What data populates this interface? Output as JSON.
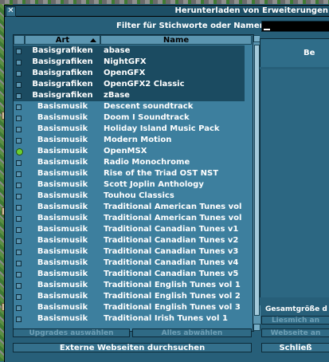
{
  "window": {
    "title": "Herunterladen von Erweiterungen",
    "close_symbol": "✕"
  },
  "filter": {
    "label": "Filter für Stichworte oder Namen:",
    "value": ""
  },
  "list": {
    "columns": {
      "type": "Art",
      "name": "Name"
    },
    "sort": "ascending",
    "rows": [
      {
        "type": "Basisgrafiken",
        "name": "abase",
        "state": "none",
        "selected": true
      },
      {
        "type": "Basisgrafiken",
        "name": "NightGFX",
        "state": "none",
        "selected": true
      },
      {
        "type": "Basisgrafiken",
        "name": "OpenGFX",
        "state": "none",
        "selected": true
      },
      {
        "type": "Basisgrafiken",
        "name": "OpenGFX2 Classic",
        "state": "none",
        "selected": true
      },
      {
        "type": "Basisgrafiken",
        "name": "zBase",
        "state": "none",
        "selected": true
      },
      {
        "type": "Basismusik",
        "name": "Descent soundtrack",
        "state": "none",
        "selected": false
      },
      {
        "type": "Basismusik",
        "name": "Doom I Soundtrack",
        "state": "none",
        "selected": false
      },
      {
        "type": "Basismusik",
        "name": "Holiday Island Music Pack",
        "state": "none",
        "selected": false
      },
      {
        "type": "Basismusik",
        "name": "Modern Motion",
        "state": "none",
        "selected": false
      },
      {
        "type": "Basismusik",
        "name": "OpenMSX",
        "state": "installed",
        "selected": false
      },
      {
        "type": "Basismusik",
        "name": "Radio Monochrome",
        "state": "none",
        "selected": false
      },
      {
        "type": "Basismusik",
        "name": "Rise of the Triad OST NST",
        "state": "none",
        "selected": false
      },
      {
        "type": "Basismusik",
        "name": "Scott Joplin Anthology",
        "state": "none",
        "selected": false
      },
      {
        "type": "Basismusik",
        "name": "Touhou Classics",
        "state": "none",
        "selected": false
      },
      {
        "type": "Basismusik",
        "name": "Traditional American Tunes vol",
        "state": "none",
        "selected": false
      },
      {
        "type": "Basismusik",
        "name": "Traditional American Tunes vol",
        "state": "none",
        "selected": false
      },
      {
        "type": "Basismusik",
        "name": "Traditional Canadian Tunes v1",
        "state": "none",
        "selected": false
      },
      {
        "type": "Basismusik",
        "name": "Traditional Canadian Tunes v2",
        "state": "none",
        "selected": false
      },
      {
        "type": "Basismusik",
        "name": "Traditional Canadian Tunes v3",
        "state": "none",
        "selected": false
      },
      {
        "type": "Basismusik",
        "name": "Traditional Canadian Tunes v4",
        "state": "none",
        "selected": false
      },
      {
        "type": "Basismusik",
        "name": "Traditional Canadian Tunes v5",
        "state": "none",
        "selected": false
      },
      {
        "type": "Basismusik",
        "name": "Traditional English Tunes vol 1",
        "state": "none",
        "selected": false
      },
      {
        "type": "Basismusik",
        "name": "Traditional English Tunes vol 2",
        "state": "none",
        "selected": false
      },
      {
        "type": "Basismusik",
        "name": "Traditional English Tunes vol 3",
        "state": "none",
        "selected": false
      },
      {
        "type": "Basismusik",
        "name": "Traditional Irish Tunes vol 1",
        "state": "none",
        "selected": false
      }
    ]
  },
  "buttons": {
    "select_upgrades": "Upgrades auswählen",
    "deselect_all": "Alles abwählen",
    "external_sites": "Externe Webseiten durchsuchen",
    "readme": "Liesmich an",
    "website": "Webseite an",
    "close": "Schließ"
  },
  "right_panel": {
    "info_text": "Be",
    "total_size": "Gesamtgröße d"
  },
  "colors": {
    "window_bg": "#275f79",
    "list_bg": "#3d7f9e",
    "selected_row": "#1b4b61",
    "installed_dot": "#6ccf2f"
  }
}
